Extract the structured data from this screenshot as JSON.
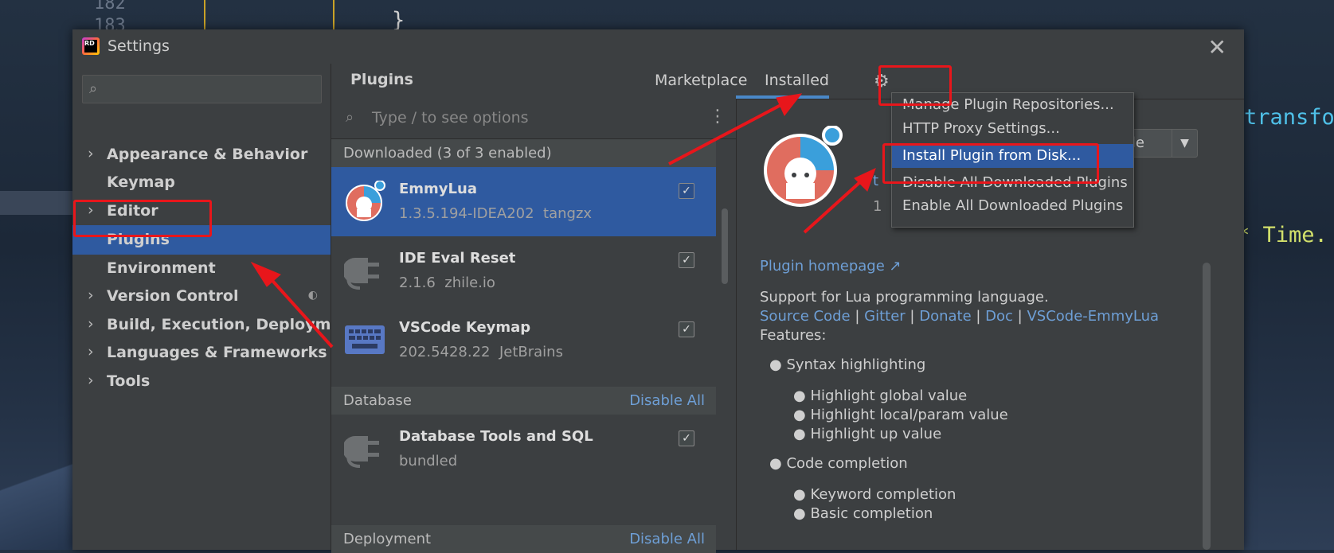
{
  "background_editor": {
    "line_numbers": [
      "182",
      "183"
    ],
    "code_fragments": [
      "}",
      "transfo",
      "* Time."
    ]
  },
  "window": {
    "title": "Settings",
    "app_icon_text": "RD"
  },
  "sidebar": {
    "search_placeholder": "",
    "items": [
      {
        "label": "Appearance & Behavior",
        "expandable": true
      },
      {
        "label": "Keymap",
        "expandable": false
      },
      {
        "label": "Editor",
        "expandable": true
      },
      {
        "label": "Plugins",
        "expandable": false,
        "selected": true
      },
      {
        "label": "Environment",
        "expandable": false
      },
      {
        "label": "Version Control",
        "expandable": true
      },
      {
        "label": "Build, Execution, Deployment",
        "expandable": true
      },
      {
        "label": "Languages & Frameworks",
        "expandable": true
      },
      {
        "label": "Tools",
        "expandable": true
      }
    ]
  },
  "plugins": {
    "title": "Plugins",
    "tabs": [
      {
        "label": "Marketplace"
      },
      {
        "label": "Installed",
        "active": true
      }
    ],
    "search_placeholder": "Type / to see options",
    "groups": [
      {
        "label": "Downloaded (3 of 3 enabled)",
        "action": "",
        "items": [
          {
            "name": "EmmyLua",
            "meta": "1.3.5.194-IDEA202  tangzx",
            "checked": true,
            "selected": true,
            "icon": "emmylua-icon"
          },
          {
            "name": "IDE Eval Reset",
            "meta": "2.1.6  zhile.io",
            "checked": true,
            "selected": false,
            "icon": "plug-icon"
          },
          {
            "name": "VSCode Keymap",
            "meta": "202.5428.22  JetBrains",
            "checked": true,
            "selected": false,
            "icon": "keyboard-icon"
          }
        ]
      },
      {
        "label": "Database",
        "action": "Disable All",
        "items": [
          {
            "name": "Database Tools and SQL",
            "meta": "bundled",
            "checked": true,
            "selected": false,
            "icon": "plug-icon"
          }
        ]
      },
      {
        "label": "Deployment",
        "action": "Disable All",
        "items": []
      }
    ],
    "detail": {
      "partial_name": "t",
      "partial_version": "1",
      "disable_label": "isable",
      "homepage": "Plugin homepage ↗",
      "description": "Support for Lua programming language.",
      "links": [
        "Source Code",
        "Gitter",
        "Donate",
        "Doc",
        "VSCode-EmmyLua"
      ],
      "link_separator": " | ",
      "features_label": "Features:",
      "features": [
        {
          "label": "Syntax highlighting",
          "sub": [
            "Highlight global value",
            "Highlight local/param value",
            "Highlight up value"
          ]
        },
        {
          "label": "Code completion",
          "sub": [
            "Keyword completion",
            "Basic completion"
          ]
        }
      ]
    },
    "gear_menu": {
      "items": [
        {
          "label": "Manage Plugin Repositories..."
        },
        {
          "label": "HTTP Proxy Settings..."
        },
        {
          "label": "Install Plugin from Disk...",
          "highlighted": true
        },
        {
          "label": "Disable All Downloaded Plugins"
        },
        {
          "label": "Enable All Downloaded Plugins"
        }
      ]
    }
  },
  "colors": {
    "accent_selection": "#2f5aa0",
    "link": "#6e9fd6",
    "annotation_red": "#e8161b"
  }
}
